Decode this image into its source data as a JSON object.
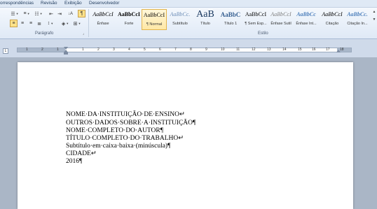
{
  "menu": [
    "orrespondências",
    "Revisão",
    "Exibição",
    "Desenvolvedor"
  ],
  "ribbon": {
    "paragraph_label": "Parágrafo",
    "styles_label": "Estilo",
    "pilcrow": "¶",
    "sort_glyph": "↓A",
    "styles": [
      {
        "preview": "AaBbCcI",
        "name": "Ênfase"
      },
      {
        "preview": "AaBbCcI",
        "name": "Forte"
      },
      {
        "preview": "AaBbCcI",
        "name": "¶ Normal",
        "selected": true
      },
      {
        "preview": "AaBbCc.",
        "name": "Subtítulo"
      },
      {
        "preview": "AaB",
        "name": "Título"
      },
      {
        "preview": "AaBbC",
        "name": "Título 1"
      },
      {
        "preview": "AaBbCcI",
        "name": "¶ Sem Esp..."
      },
      {
        "preview": "AaBbCcI",
        "name": "Ênfase Sutil"
      },
      {
        "preview": "AaBbCc",
        "name": "Ênfase Int..."
      },
      {
        "preview": "AaBbCcI",
        "name": "Citação"
      },
      {
        "preview": "AaBbCc.",
        "name": "Citação In..."
      }
    ]
  },
  "ruler": {
    "tab_selector": "L",
    "numbers": [
      "1",
      "2",
      "1",
      "1",
      "2",
      "3",
      "4",
      "5",
      "6",
      "7",
      "8",
      "9",
      "10",
      "11",
      "12",
      "13",
      "14",
      "15",
      "16",
      "17",
      "18"
    ]
  },
  "document": {
    "lines": [
      "NOME·DA·INSTITUIÇÃO·DE·ENSINO↵",
      "OUTROS·DADOS·SOBRE·A·INSTITUIÇÃO¶",
      "NOME·COMPLETO·DO·AUTOR¶",
      "TÍTULO·COMPLETO·DO·TRABALHO↵",
      "Subtítulo·em·caixa·baixa·(minúscula)¶",
      "CIDADE↵",
      "2016¶"
    ]
  }
}
